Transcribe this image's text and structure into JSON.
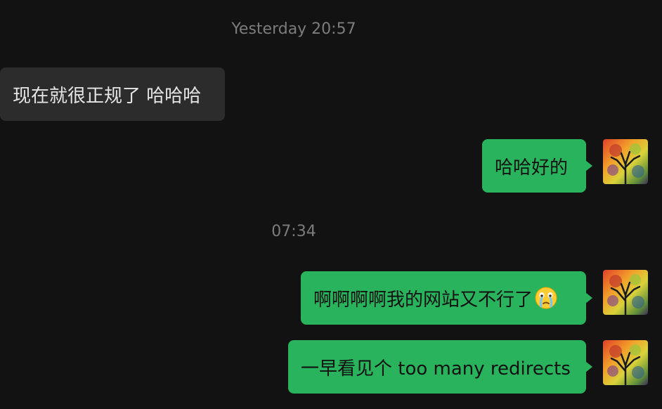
{
  "timestamps": {
    "first": "Yesterday 20:57",
    "second": "07:34"
  },
  "messages": [
    {
      "direction": "incoming",
      "text": "现在就很正规了 哈哈哈"
    },
    {
      "direction": "outgoing",
      "text": "哈哈好的"
    },
    {
      "direction": "outgoing",
      "text": "啊啊啊啊我的网站又不行了",
      "emoji": "crying-face-emoji"
    },
    {
      "direction": "outgoing",
      "text": "一早看见个 too many redirects"
    }
  ],
  "avatar": {
    "icon": "tree-of-life-avatar"
  },
  "colors": {
    "background": "#121212",
    "incoming_bubble": "#2c2c2c",
    "outgoing_bubble": "#29b35d",
    "timestamp_text": "#7c7c7c"
  }
}
